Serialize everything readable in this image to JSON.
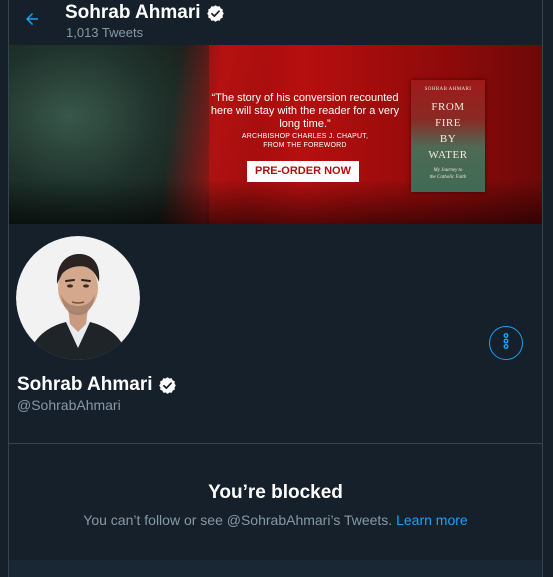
{
  "colors": {
    "background": "#15202b",
    "border": "#38444d",
    "accent": "#1da1f2",
    "secondary_text": "#8899a6",
    "primary_text": "#ffffff"
  },
  "header": {
    "back_icon": "arrow-left-icon",
    "name": "Sohrab Ahmari",
    "verified_icon": "verified-badge-icon",
    "tweet_count": "1,013 Tweets"
  },
  "banner": {
    "quote": "“The story of his conversion recounted here will stay with the reader for a very long time.”",
    "attribution_line1": "ARCHBISHOP CHARLES J. CHAPUT,",
    "attribution_line2": "FROM THE FOREWORD",
    "cta": "PRE-ORDER NOW",
    "book": {
      "author": "SOHRAB AHMARI",
      "title_line1": "FROM",
      "title_line2": "FIRE",
      "title_line3": "BY",
      "title_line4": "WATER",
      "subtitle_line1": "My Journey to",
      "subtitle_line2": "the Catholic Faith"
    }
  },
  "profile": {
    "avatar_icon": "profile-photo",
    "more_icon": "more-vertical-icon",
    "name": "Sohrab Ahmari",
    "verified_icon": "verified-badge-icon",
    "handle": "@SohrabAhmari"
  },
  "blocked": {
    "title": "You’re blocked",
    "message": "You can’t follow or see @SohrabAhmari’s Tweets.",
    "link": "Learn more"
  }
}
